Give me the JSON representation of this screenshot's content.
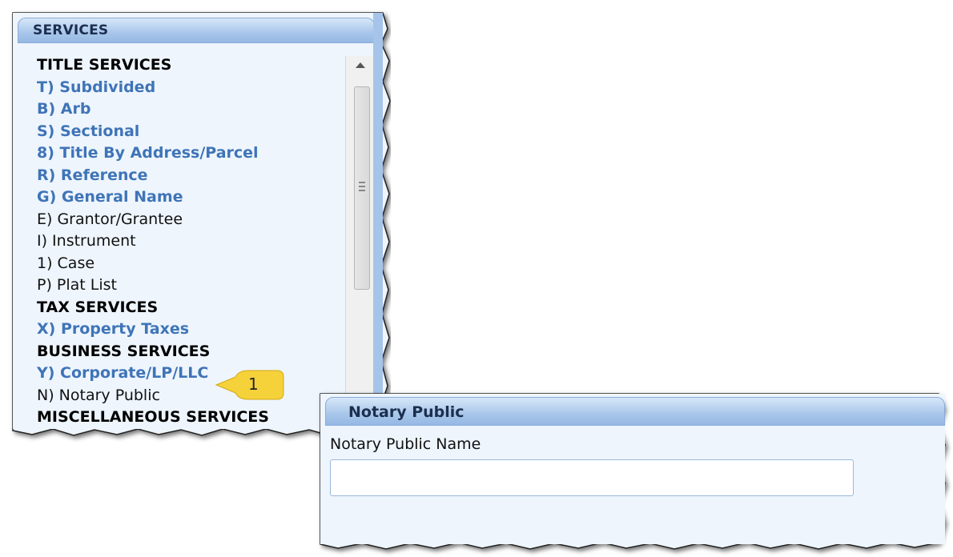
{
  "services_panel": {
    "title": "SERVICES",
    "items": [
      {
        "label": "TITLE SERVICES",
        "kind": "heading"
      },
      {
        "label": "T) Subdivided",
        "kind": "active"
      },
      {
        "label": "B) Arb",
        "kind": "active"
      },
      {
        "label": "S) Sectional",
        "kind": "active"
      },
      {
        "label": "8) Title By Address/Parcel",
        "kind": "active"
      },
      {
        "label": "R) Reference",
        "kind": "active"
      },
      {
        "label": "G) General Name",
        "kind": "active"
      },
      {
        "label": "E) Grantor/Grantee",
        "kind": "plain"
      },
      {
        "label": "I) Instrument",
        "kind": "plain"
      },
      {
        "label": "1) Case",
        "kind": "plain"
      },
      {
        "label": "P) Plat List",
        "kind": "plain"
      },
      {
        "label": "TAX SERVICES",
        "kind": "heading"
      },
      {
        "label": "X) Property Taxes",
        "kind": "active"
      },
      {
        "label": "BUSINESS SERVICES",
        "kind": "heading"
      },
      {
        "label": "Y) Corporate/LP/LLC",
        "kind": "active"
      },
      {
        "label": "N) Notary Public",
        "kind": "plain"
      },
      {
        "label": "MISCELLANEOUS SERVICES",
        "kind": "heading"
      }
    ]
  },
  "callout": {
    "number": "1",
    "color": "#f5d13a"
  },
  "notary_panel": {
    "title": "Notary Public",
    "field_label": "Notary Public Name",
    "field_value": ""
  },
  "colors": {
    "header_blue": "#a8c6ea",
    "panel_bg": "#eef5fd",
    "link_blue": "#3f74b7"
  }
}
